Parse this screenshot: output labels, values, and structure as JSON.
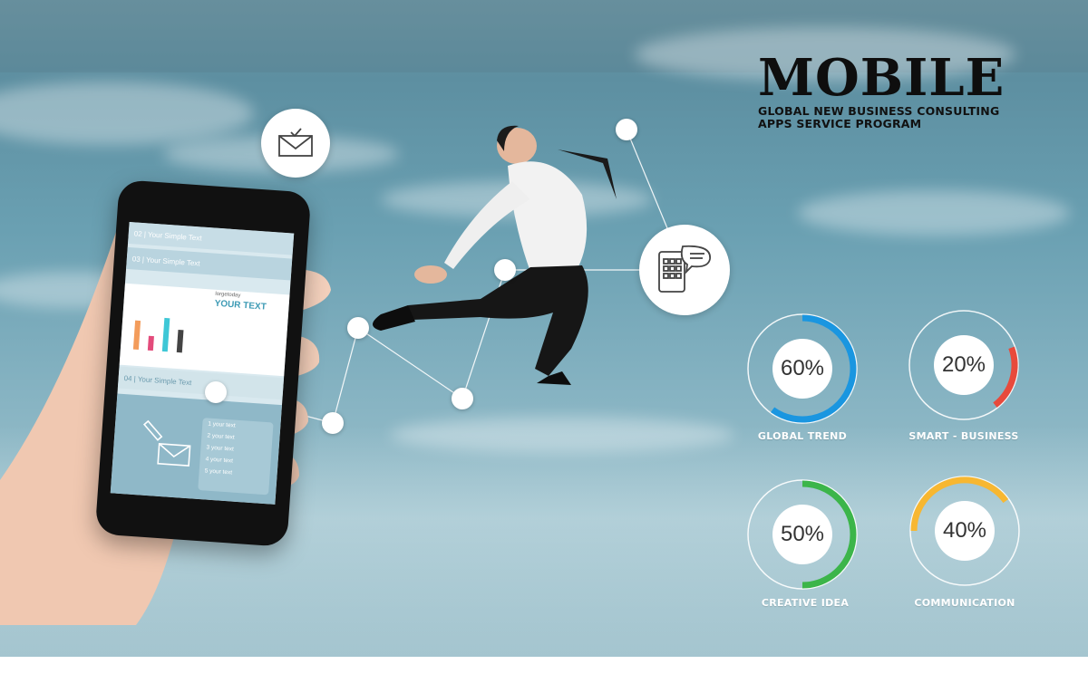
{
  "brand": {
    "title": "MOBILE",
    "subtitle_line1": "GLOBAL NEW BUSINESS CONSULTING",
    "subtitle_line2": "APPS SERVICE PROGRAM"
  },
  "icons": {
    "mail": "envelope-check-icon",
    "tablet_chat": "tablet-chat-icon"
  },
  "gauges": [
    {
      "value": "60%",
      "label": "GLOBAL TREND",
      "percent": 60,
      "color": "#1a96e0"
    },
    {
      "value": "20%",
      "label": "SMART - BUSINESS",
      "percent": 20,
      "color": "#e84a3c"
    },
    {
      "value": "50%",
      "label": "CREATIVE IDEA",
      "percent": 50,
      "color": "#3cb54a"
    },
    {
      "value": "40%",
      "label": "COMMUNICATION",
      "percent": 40,
      "color": "#f7b731"
    }
  ],
  "phone_screen": {
    "row_02": "02  |  Your Simple Text",
    "row_03": "03  |  Your Simple Text",
    "card_small": "lorgetoday",
    "card_title": "YOUR TEXT",
    "row_04": "04  |  Your Simple Text",
    "list": [
      "1    your text",
      "2    your text",
      "3    your text",
      "4    your text",
      "5    your text"
    ],
    "bars": [
      0.7,
      0.35,
      0.8,
      0.55
    ]
  }
}
